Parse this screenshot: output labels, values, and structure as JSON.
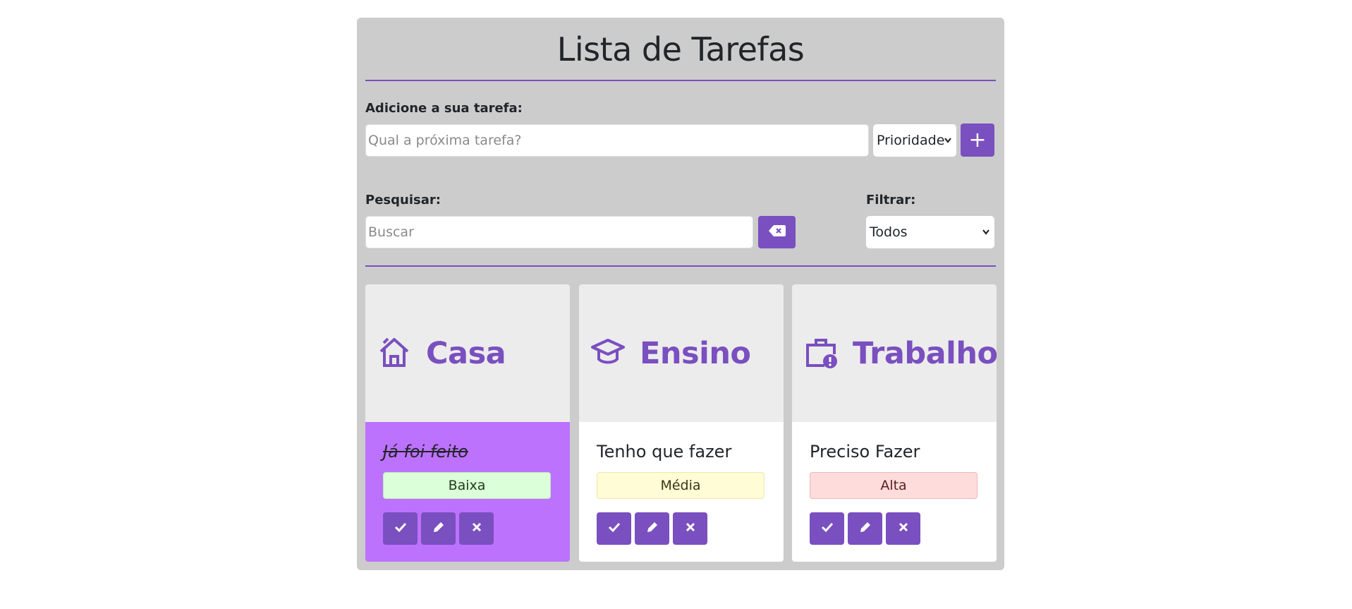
{
  "header": {
    "title": "Lista de Tarefas"
  },
  "add": {
    "label": "Adicione a sua tarefa:",
    "placeholder": "Qual a próxima tarefa?",
    "priority_select": "Prioridade",
    "add_button": "+"
  },
  "search": {
    "label": "Pesquisar:",
    "placeholder": "Buscar"
  },
  "filter": {
    "label": "Filtrar:",
    "selected": "Todos"
  },
  "columns": [
    {
      "name": "Casa",
      "icon": "home-icon",
      "task": {
        "text": "Já foi feito",
        "priority": "Baixa",
        "done": true
      }
    },
    {
      "name": "Ensino",
      "icon": "graduation-cap-icon",
      "task": {
        "text": "Tenho que fazer",
        "priority": "Média",
        "done": false
      }
    },
    {
      "name": "Trabalho",
      "icon": "briefcase-alert-icon",
      "task": {
        "text": "Preciso Fazer",
        "priority": "Alta",
        "done": false
      }
    }
  ],
  "colors": {
    "accent": "#7a4fbf",
    "done_card": "#bd72fe",
    "panel": "#cccccc"
  }
}
